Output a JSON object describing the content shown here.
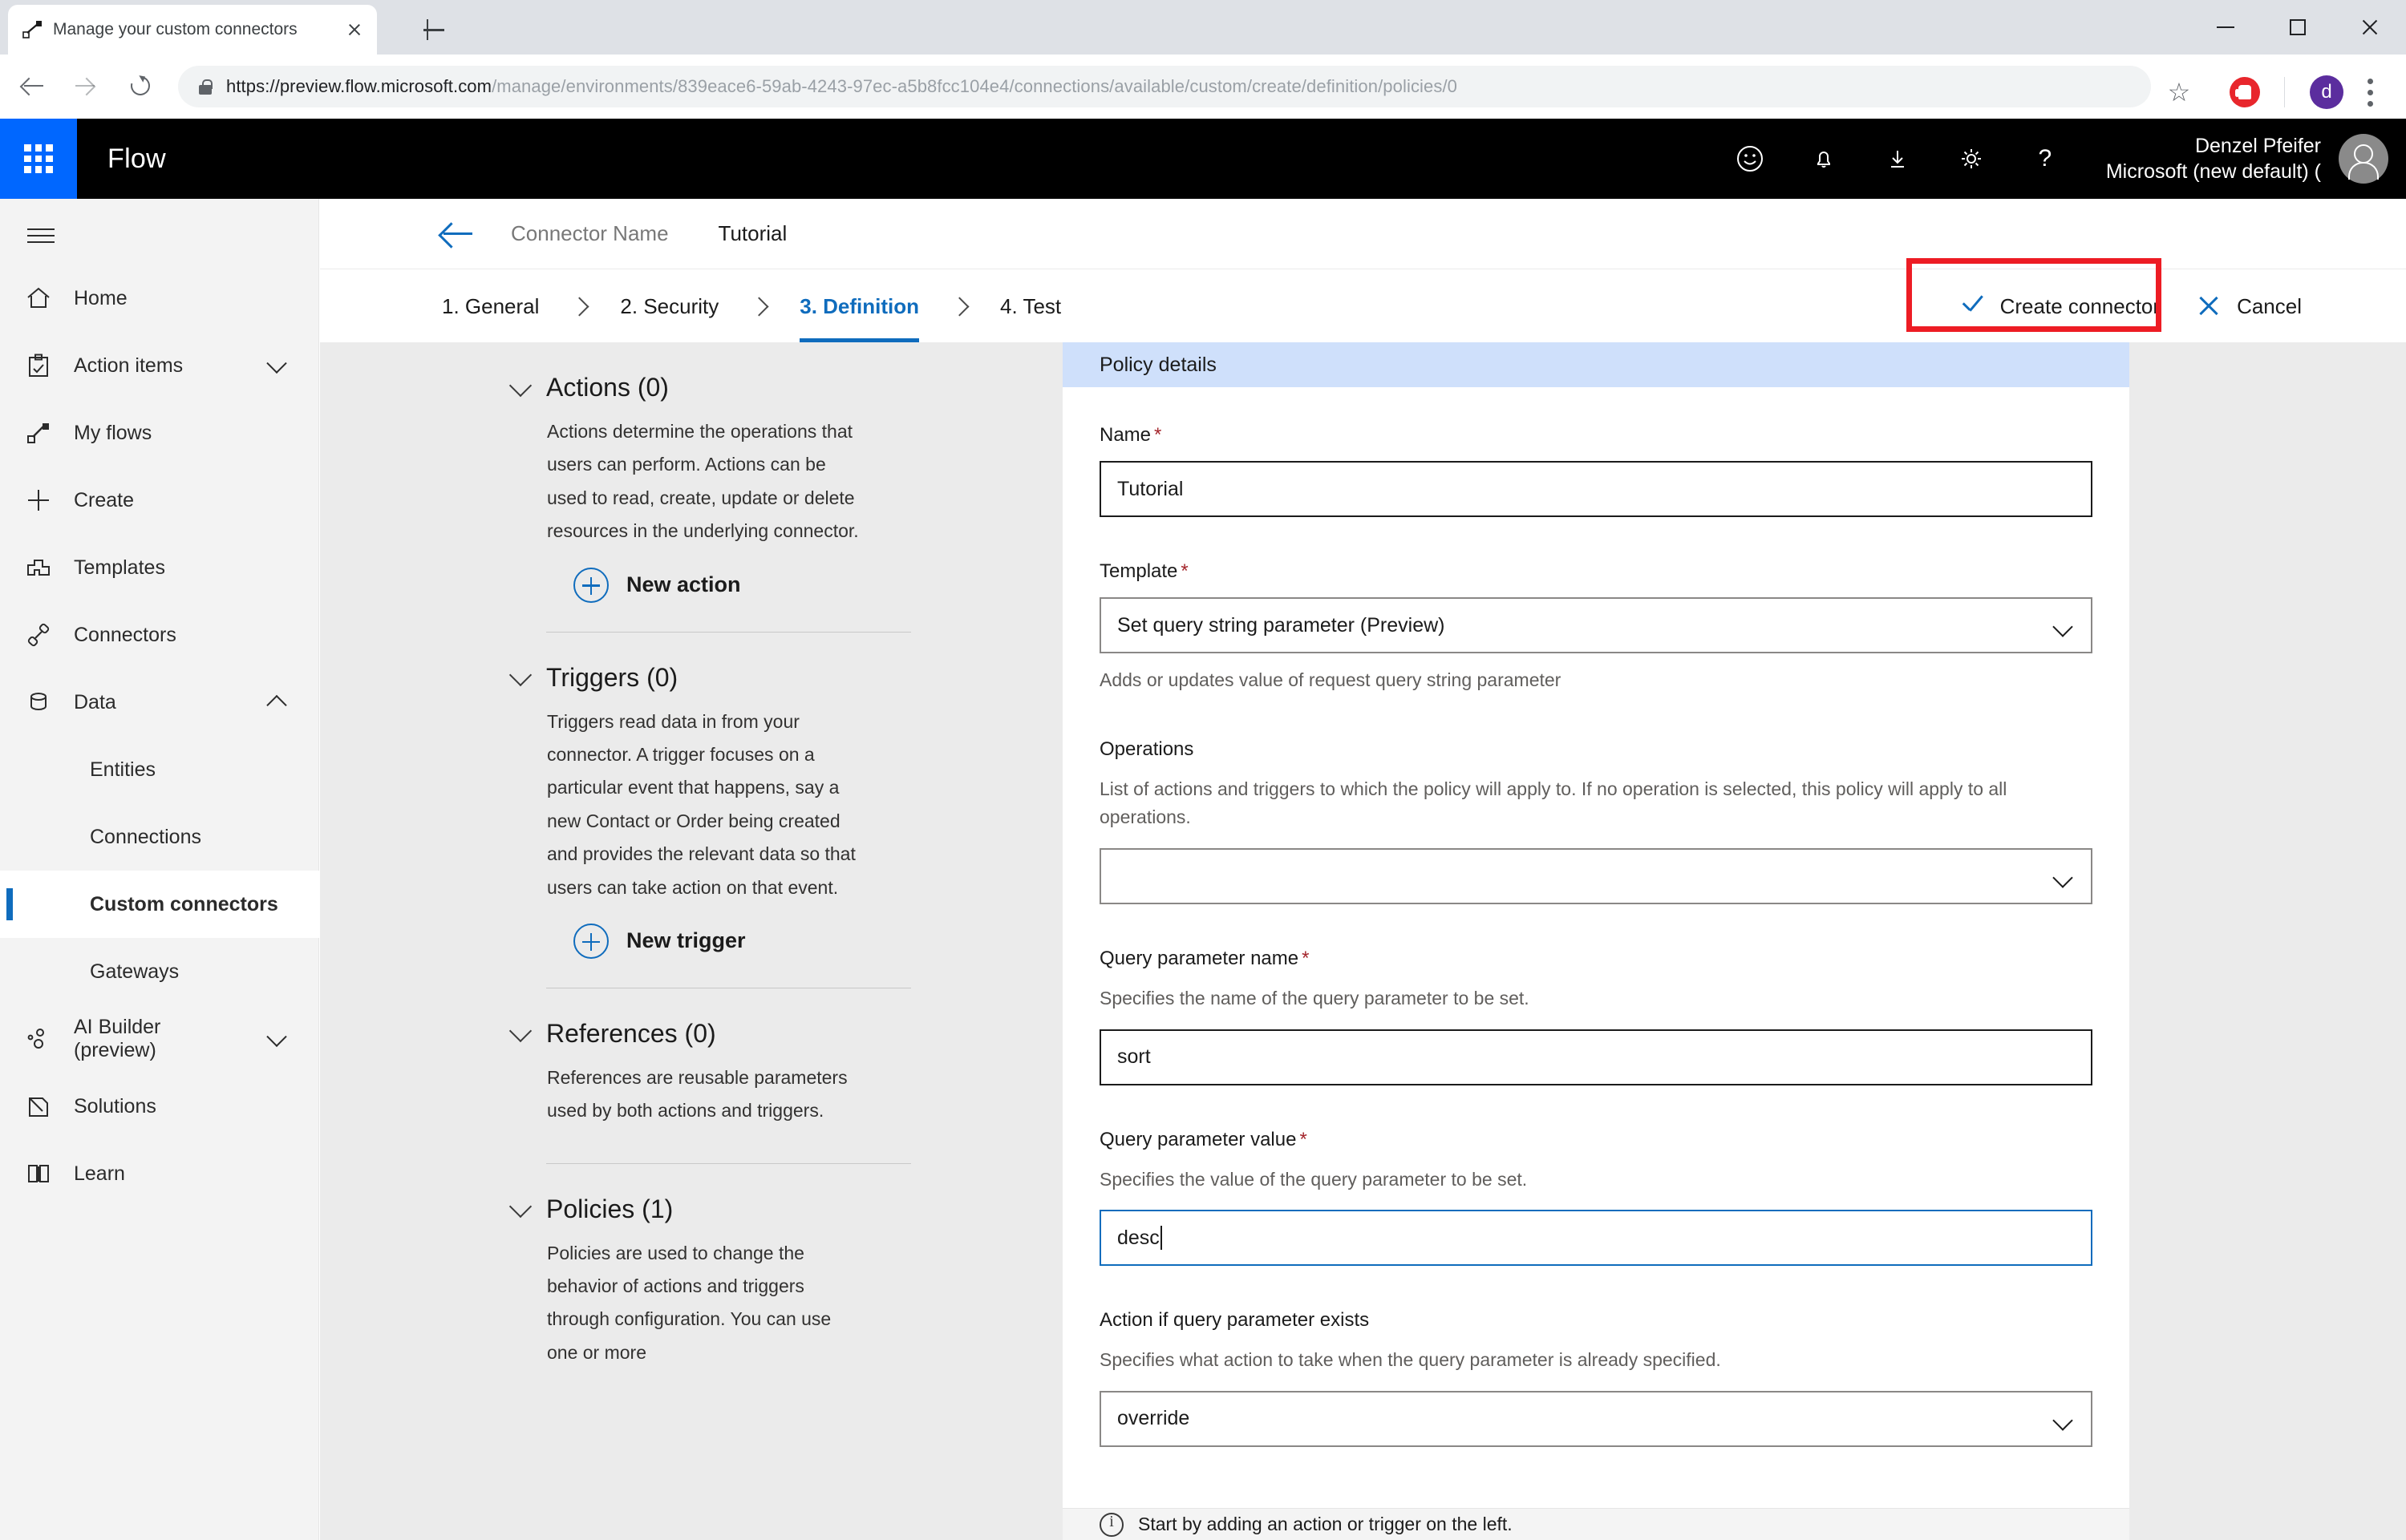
{
  "browser": {
    "tab_title": "Manage your custom connectors",
    "url_scheme_host": "https://preview.flow.microsoft.com",
    "url_path": "/manage/environments/839eace6-59ab-4243-97ec-a5b8fcc104e4/connections/available/custom/create/definition/policies/0",
    "profile_initial": "d"
  },
  "suitebar": {
    "brand": "Flow",
    "user_name": "Denzel Pfeifer",
    "user_org": "Microsoft (new default) ("
  },
  "sidebar": {
    "items": [
      {
        "label": "Home",
        "icon": "home-icon",
        "sub": false,
        "chevron": ""
      },
      {
        "label": "Action items",
        "icon": "clipboard-check-icon",
        "sub": false,
        "chevron": "down"
      },
      {
        "label": "My flows",
        "icon": "flow-icon",
        "sub": false,
        "chevron": ""
      },
      {
        "label": "Create",
        "icon": "plus-icon",
        "sub": false,
        "chevron": ""
      },
      {
        "label": "Templates",
        "icon": "templates-icon",
        "sub": false,
        "chevron": ""
      },
      {
        "label": "Connectors",
        "icon": "connectors-icon",
        "sub": false,
        "chevron": ""
      },
      {
        "label": "Data",
        "icon": "database-icon",
        "sub": false,
        "chevron": "up"
      },
      {
        "label": "Entities",
        "icon": "",
        "sub": true,
        "chevron": ""
      },
      {
        "label": "Connections",
        "icon": "",
        "sub": true,
        "chevron": ""
      },
      {
        "label": "Custom connectors",
        "icon": "",
        "sub": true,
        "chevron": "",
        "active": true
      },
      {
        "label": "Gateways",
        "icon": "",
        "sub": true,
        "chevron": ""
      },
      {
        "label": "AI Builder (preview)",
        "icon": "ai-builder-icon",
        "sub": false,
        "chevron": "down"
      },
      {
        "label": "Solutions",
        "icon": "solutions-icon",
        "sub": false,
        "chevron": ""
      },
      {
        "label": "Learn",
        "icon": "book-icon",
        "sub": false,
        "chevron": ""
      }
    ]
  },
  "header": {
    "breadcrumb_label": "Connector Name",
    "breadcrumb_value": "Tutorial",
    "steps": [
      {
        "label": "1. General"
      },
      {
        "label": "2. Security"
      },
      {
        "label": "3. Definition",
        "current": true
      },
      {
        "label": "4. Test"
      }
    ],
    "create_connector": "Create connector",
    "cancel": "Cancel"
  },
  "left_panel": {
    "sections": [
      {
        "title": "Actions (0)",
        "desc": "Actions determine the operations that users can perform. Actions can be used to read, create, update or delete resources in the underlying connector.",
        "button": "New action"
      },
      {
        "title": "Triggers (0)",
        "desc": "Triggers read data in from your connector. A trigger focuses on a particular event that happens, say a new Contact or Order being created and provides the relevant data so that users can take action on that event.",
        "button": "New trigger"
      },
      {
        "title": "References (0)",
        "desc": "References are reusable parameters used by both actions and triggers.",
        "button": ""
      },
      {
        "title": "Policies (1)",
        "desc": "Policies are used to change the behavior of actions and triggers through configuration. You can use one or more",
        "button": ""
      }
    ]
  },
  "policy_panel": {
    "heading": "Policy details",
    "name_label": "Name",
    "name_value": "Tutorial",
    "template_label": "Template",
    "template_value": "Set query string parameter (Preview)",
    "template_help": "Adds or updates value of request query string parameter",
    "operations_label": "Operations",
    "operations_help": "List of actions and triggers to which the policy will apply to. If no operation is selected, this policy will apply to all operations.",
    "operations_value": "",
    "qp_name_label": "Query parameter name",
    "qp_name_help": "Specifies the name of the query parameter to be set.",
    "qp_name_value": "sort",
    "qp_value_label": "Query parameter value",
    "qp_value_help": "Specifies the value of the query parameter to be set.",
    "qp_value_value": "desc",
    "action_label": "Action if query parameter exists",
    "action_help": "Specifies what action to take when the query parameter is already specified.",
    "action_value": "override",
    "required_marker": "*"
  },
  "status": {
    "message": "Start by adding an action or trigger on the left."
  },
  "colors": {
    "accent": "#0f6cbd",
    "highlight_box": "#ed1c24",
    "panel_header": "#cfe0fb",
    "suitebar": "#000000",
    "waffle": "#0067ff"
  }
}
